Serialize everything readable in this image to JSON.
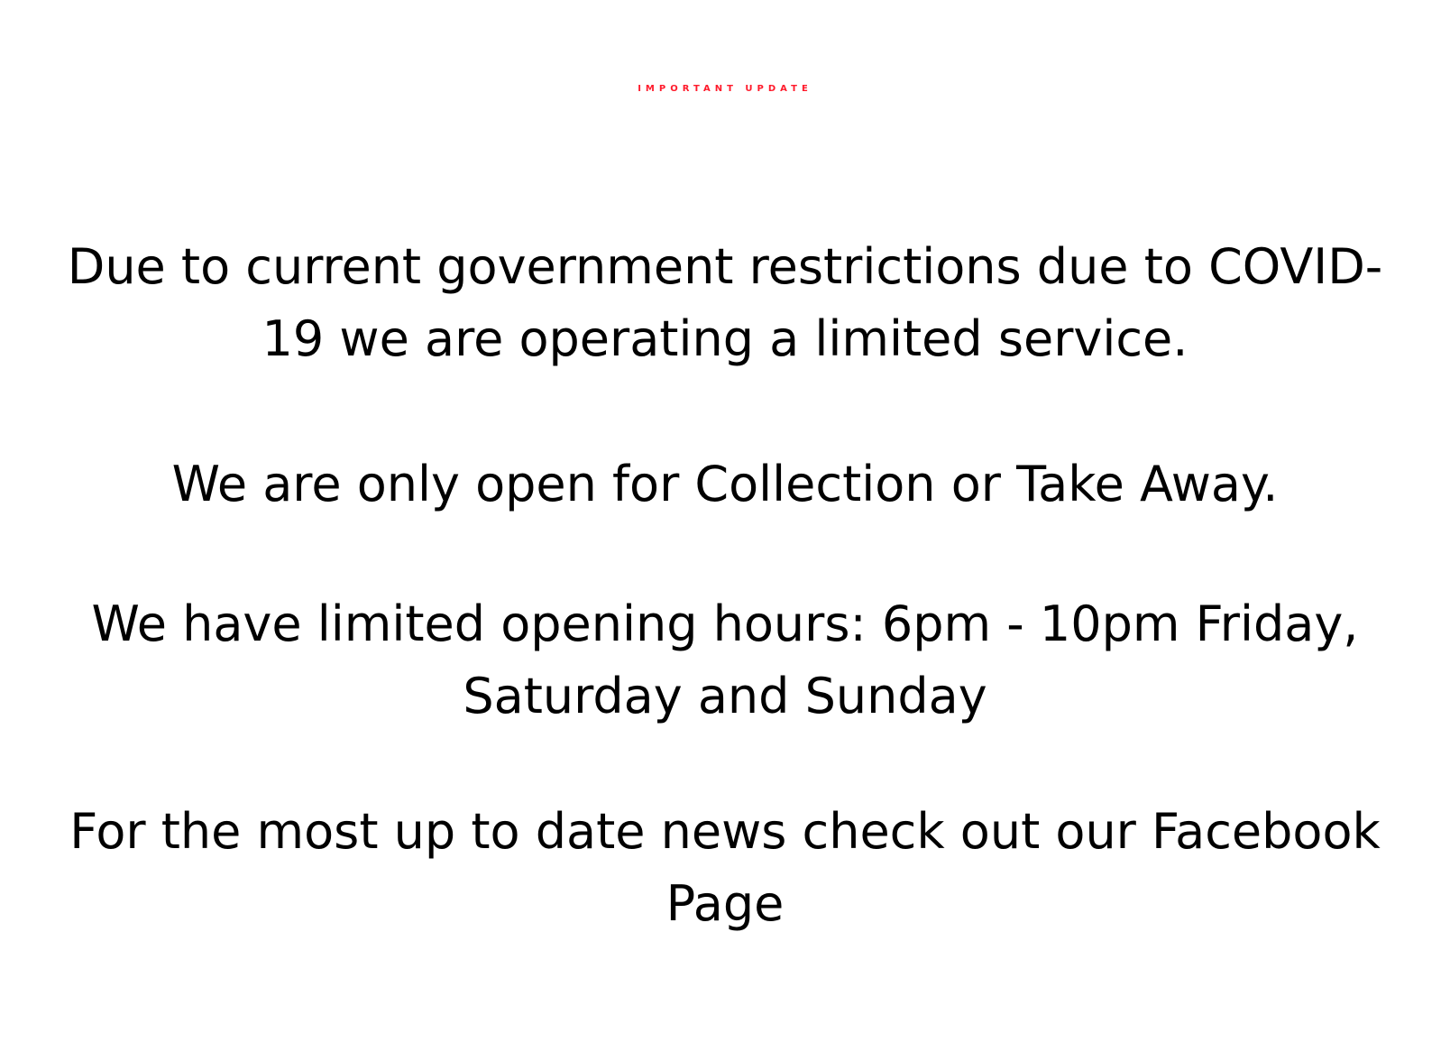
{
  "notice": {
    "headline": "IMPORTANT UPDATE",
    "accent_color": "#ff1a2b",
    "text_color": "#000000",
    "paragraphs": [
      {
        "lines": [
          "Due to current government restrictions due to COVID-",
          "19 we are operating a limited service."
        ]
      },
      {
        "lines": [
          "We are only open for Collection or Take Away."
        ]
      },
      {
        "lines": [
          "We have limited opening hours: 6pm - 10pm Friday,",
          "Saturday and Sunday"
        ]
      },
      {
        "lines": [
          "For the most up to date news check out our Facebook",
          "Page"
        ]
      }
    ]
  }
}
